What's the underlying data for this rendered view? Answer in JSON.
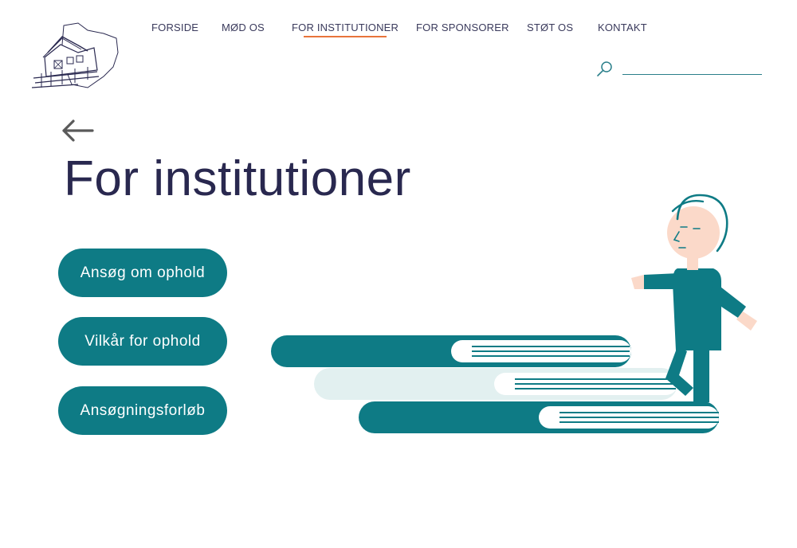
{
  "nav": {
    "items": [
      {
        "label": "FORSIDE",
        "active": false
      },
      {
        "label": "MØD OS",
        "active": false
      },
      {
        "label": "FOR INSTITUTIONER",
        "active": true
      },
      {
        "label": "FOR SPONSORER",
        "active": false
      },
      {
        "label": "STØT OS",
        "active": false
      },
      {
        "label": "KONTAKT",
        "active": false
      }
    ]
  },
  "search": {
    "placeholder": "",
    "value": ""
  },
  "page": {
    "title": "For institutioner"
  },
  "actions": [
    {
      "label": "Ansøg om ophold"
    },
    {
      "label": "Vilkår for ophold"
    },
    {
      "label": "Ansøgningsforløb"
    }
  ],
  "colors": {
    "accent": "#e8743b",
    "teal": "#0e7b85",
    "title": "#29284f",
    "skin": "#fbd9c9",
    "pale_teal": "#e2f0f0"
  },
  "icons": {
    "back": "arrow-left-icon",
    "search": "search-icon",
    "logo": "house-logo"
  }
}
